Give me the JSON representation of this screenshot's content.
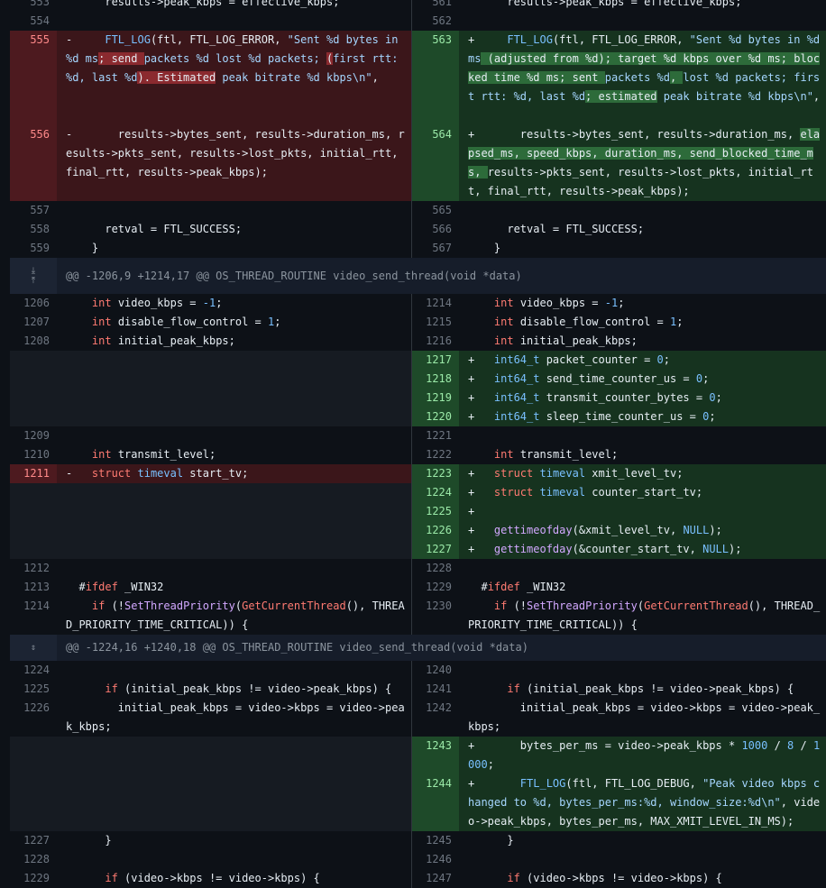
{
  "theme": {
    "background": "#0d1117",
    "deletion_line": "#3b161a",
    "addition_line": "#16331f",
    "deletion_highlight": "#8b2a2f",
    "addition_highlight": "#2d6b3a",
    "keyword": "#ff7b72",
    "type": "#79c0ff"
  },
  "diff": {
    "rows": [
      {
        "kind": "ctx",
        "h": 21,
        "l": {
          "n": "553",
          "t": "      results->peak_kbps = effective_kbps;"
        },
        "r": {
          "n": "561",
          "t": "      results->peak_kbps = effective_kbps;"
        }
      },
      {
        "kind": "ctx",
        "h": 21,
        "l": {
          "n": "554",
          "t": ""
        },
        "r": {
          "n": "562",
          "t": ""
        }
      },
      {
        "kind": "change",
        "h": 105,
        "l": {
          "n": "555",
          "segs": [
            [
              "-     ",
              ""
            ],
            [
              "FTL_LOG",
              "mac"
            ],
            [
              "(ftl, FTL_LOG_ERROR, ",
              ""
            ],
            [
              "\"Sent %d bytes in %d ms",
              "st"
            ],
            [
              "; send ",
              "hl-del"
            ],
            [
              "packets %d lost %d packets; ",
              "st"
            ],
            [
              "(",
              "hl-del"
            ],
            [
              "first rtt: %d, last %d",
              "st"
            ],
            [
              "). Estimated",
              "hl-del"
            ],
            [
              " peak bitrate %d kbps\\n\"",
              "st"
            ],
            [
              ",",
              ""
            ]
          ]
        },
        "r": {
          "n": "563",
          "segs": [
            [
              "+     ",
              ""
            ],
            [
              "FTL_LOG",
              "mac"
            ],
            [
              "(ftl, FTL_LOG_ERROR, ",
              ""
            ],
            [
              "\"Sent %d bytes in %d ms",
              "st"
            ],
            [
              " (adjusted from %d); target %d kbps over %d ms; blocked time %d ms; sent ",
              "hl-add"
            ],
            [
              "packets %d",
              "st"
            ],
            [
              ", ",
              "hl-add"
            ],
            [
              "lost %d packets; first rtt: %d, last %d",
              "st"
            ],
            [
              "; estimated",
              "hl-add"
            ],
            [
              " peak bitrate %d kbps\\n\"",
              "st"
            ],
            [
              ",",
              ""
            ]
          ]
        }
      },
      {
        "kind": "change",
        "h": 84,
        "l": {
          "n": "556",
          "segs": [
            [
              "-       results->bytes_sent, results->duration_ms, results->pkts_sent, results->lost_pkts, initial_rtt, final_rtt, results->peak_kbps);",
              ""
            ]
          ]
        },
        "r": {
          "n": "564",
          "segs": [
            [
              "+       results->bytes_sent, results->duration_ms, ",
              ""
            ],
            [
              "elapsed_ms, speed_kbps, duration_ms, send_blocked_time_ms, ",
              "hl-add"
            ],
            [
              "results->pkts_sent, results->lost_pkts, initial_rtt, final_rtt, results->peak_kbps);",
              ""
            ]
          ]
        }
      },
      {
        "kind": "ctx",
        "h": 21,
        "l": {
          "n": "557",
          "t": ""
        },
        "r": {
          "n": "565",
          "t": ""
        }
      },
      {
        "kind": "ctx",
        "h": 21,
        "l": {
          "n": "558",
          "t": "      retval = FTL_SUCCESS;"
        },
        "r": {
          "n": "566",
          "t": "      retval = FTL_SUCCESS;"
        }
      },
      {
        "kind": "ctx",
        "h": 21,
        "l": {
          "n": "559",
          "t": "    }"
        },
        "r": {
          "n": "567",
          "t": "    }"
        }
      },
      {
        "kind": "hunk",
        "h": 40,
        "t": "@@ -1206,9 +1214,17 @@ OS_THREAD_ROUTINE video_send_thread(void *data)",
        "icons": [
          "expand-down-icon",
          "expand-up-icon"
        ]
      },
      {
        "kind": "ctx",
        "h": 21,
        "l": {
          "n": "1206",
          "segs": [
            [
              "    ",
              ""
            ],
            [
              "int",
              "kw"
            ],
            [
              " video_kbps = ",
              ""
            ],
            [
              "-1",
              "nu"
            ],
            [
              ";",
              ""
            ]
          ]
        },
        "r": {
          "n": "1214",
          "segs": [
            [
              "    ",
              ""
            ],
            [
              "int",
              "kw"
            ],
            [
              " video_kbps = ",
              ""
            ],
            [
              "-1",
              "nu"
            ],
            [
              ";",
              ""
            ]
          ]
        }
      },
      {
        "kind": "ctx",
        "h": 21,
        "l": {
          "n": "1207",
          "segs": [
            [
              "    ",
              ""
            ],
            [
              "int",
              "kw"
            ],
            [
              " disable_flow_control = ",
              ""
            ],
            [
              "1",
              "nu"
            ],
            [
              ";",
              ""
            ]
          ]
        },
        "r": {
          "n": "1215",
          "segs": [
            [
              "    ",
              ""
            ],
            [
              "int",
              "kw"
            ],
            [
              " disable_flow_control = ",
              ""
            ],
            [
              "1",
              "nu"
            ],
            [
              ";",
              ""
            ]
          ]
        }
      },
      {
        "kind": "ctx",
        "h": 21,
        "l": {
          "n": "1208",
          "segs": [
            [
              "    ",
              ""
            ],
            [
              "int",
              "kw"
            ],
            [
              " initial_peak_kbps;",
              ""
            ]
          ]
        },
        "r": {
          "n": "1216",
          "segs": [
            [
              "    ",
              ""
            ],
            [
              "int",
              "kw"
            ],
            [
              " initial_peak_kbps;",
              ""
            ]
          ]
        }
      },
      {
        "kind": "add",
        "h": 21,
        "r": {
          "n": "1217",
          "segs": [
            [
              "+   ",
              ""
            ],
            [
              "int64_t",
              "ty"
            ],
            [
              " packet_counter = ",
              ""
            ],
            [
              "0",
              "nu"
            ],
            [
              ";",
              ""
            ]
          ]
        }
      },
      {
        "kind": "add",
        "h": 21,
        "r": {
          "n": "1218",
          "segs": [
            [
              "+   ",
              ""
            ],
            [
              "int64_t",
              "ty"
            ],
            [
              " send_time_counter_us = ",
              ""
            ],
            [
              "0",
              "nu"
            ],
            [
              ";",
              ""
            ]
          ]
        }
      },
      {
        "kind": "add",
        "h": 21,
        "r": {
          "n": "1219",
          "segs": [
            [
              "+   ",
              ""
            ],
            [
              "int64_t",
              "ty"
            ],
            [
              " transmit_counter_bytes = ",
              ""
            ],
            [
              "0",
              "nu"
            ],
            [
              ";",
              ""
            ]
          ]
        }
      },
      {
        "kind": "add",
        "h": 21,
        "r": {
          "n": "1220",
          "segs": [
            [
              "+   ",
              ""
            ],
            [
              "int64_t",
              "ty"
            ],
            [
              " sleep_time_counter_us = ",
              ""
            ],
            [
              "0",
              "nu"
            ],
            [
              ";",
              ""
            ]
          ]
        }
      },
      {
        "kind": "ctx",
        "h": 21,
        "l": {
          "n": "1209",
          "t": ""
        },
        "r": {
          "n": "1221",
          "t": ""
        }
      },
      {
        "kind": "ctx",
        "h": 21,
        "l": {
          "n": "1210",
          "segs": [
            [
              "    ",
              ""
            ],
            [
              "int",
              "kw"
            ],
            [
              " transmit_level;",
              ""
            ]
          ]
        },
        "r": {
          "n": "1222",
          "segs": [
            [
              "    ",
              ""
            ],
            [
              "int",
              "kw"
            ],
            [
              " transmit_level;",
              ""
            ]
          ]
        }
      },
      {
        "kind": "change",
        "h": 21,
        "l": {
          "n": "1211",
          "segs": [
            [
              "-   ",
              ""
            ],
            [
              "struct",
              "kw"
            ],
            [
              " ",
              ""
            ],
            [
              "timeval",
              "ty"
            ],
            [
              " start_tv;",
              ""
            ]
          ]
        },
        "r": {
          "n": "1223",
          "segs": [
            [
              "+   ",
              ""
            ],
            [
              "struct",
              "kw"
            ],
            [
              " ",
              ""
            ],
            [
              "timeval",
              "ty"
            ],
            [
              " xmit_level_tv;",
              ""
            ]
          ]
        }
      },
      {
        "kind": "add",
        "h": 21,
        "r": {
          "n": "1224",
          "segs": [
            [
              "+   ",
              ""
            ],
            [
              "struct",
              "kw"
            ],
            [
              " ",
              ""
            ],
            [
              "timeval",
              "ty"
            ],
            [
              " counter_start_tv;",
              ""
            ]
          ]
        }
      },
      {
        "kind": "add",
        "h": 21,
        "r": {
          "n": "1225",
          "segs": [
            [
              "+",
              ""
            ]
          ]
        }
      },
      {
        "kind": "add",
        "h": 21,
        "r": {
          "n": "1226",
          "segs": [
            [
              "+   ",
              ""
            ],
            [
              "gettimeofday",
              "fn"
            ],
            [
              "(&xmit_level_tv, ",
              ""
            ],
            [
              "NULL",
              "nu"
            ],
            [
              ");",
              ""
            ]
          ]
        }
      },
      {
        "kind": "add",
        "h": 21,
        "r": {
          "n": "1227",
          "segs": [
            [
              "+   ",
              ""
            ],
            [
              "gettimeofday",
              "fn"
            ],
            [
              "(&counter_start_tv, ",
              ""
            ],
            [
              "NULL",
              "nu"
            ],
            [
              ");",
              ""
            ]
          ]
        }
      },
      {
        "kind": "ctx",
        "h": 21,
        "l": {
          "n": "1212",
          "t": ""
        },
        "r": {
          "n": "1228",
          "t": ""
        }
      },
      {
        "kind": "ctx",
        "h": 21,
        "l": {
          "n": "1213",
          "segs": [
            [
              "  #",
              ""
            ],
            [
              "ifdef",
              "kw"
            ],
            [
              " _WIN32",
              ""
            ]
          ]
        },
        "r": {
          "n": "1229",
          "segs": [
            [
              "  #",
              ""
            ],
            [
              "ifdef",
              "kw"
            ],
            [
              " _WIN32",
              ""
            ]
          ]
        }
      },
      {
        "kind": "ctx",
        "h": 42,
        "l": {
          "n": "1214",
          "segs": [
            [
              "    ",
              ""
            ],
            [
              "if",
              "kw"
            ],
            [
              " (!",
              ""
            ],
            [
              "SetThreadPriority",
              "fn"
            ],
            [
              "(",
              ""
            ],
            [
              "GetCurrentThread",
              "kw"
            ],
            [
              "(), THREAD_PRIORITY_TIME_CRITICAL)) {",
              ""
            ]
          ]
        },
        "r": {
          "n": "1230",
          "segs": [
            [
              "    ",
              ""
            ],
            [
              "if",
              "kw"
            ],
            [
              " (!",
              ""
            ],
            [
              "SetThreadPriority",
              "fn"
            ],
            [
              "(",
              ""
            ],
            [
              "GetCurrentThread",
              "kw"
            ],
            [
              "(), THREAD_PRIORITY_TIME_CRITICAL)) {",
              ""
            ]
          ]
        }
      },
      {
        "kind": "hunk",
        "h": 29,
        "t": "@@ -1224,16 +1240,18 @@ OS_THREAD_ROUTINE video_send_thread(void *data)",
        "icons": [
          "expand-both-icon"
        ]
      },
      {
        "kind": "ctx",
        "h": 21,
        "l": {
          "n": "1224",
          "t": ""
        },
        "r": {
          "n": "1240",
          "t": ""
        }
      },
      {
        "kind": "ctx",
        "h": 21,
        "l": {
          "n": "1225",
          "segs": [
            [
              "      ",
              ""
            ],
            [
              "if",
              "kw"
            ],
            [
              " (initial_peak_kbps != video->peak_kbps) {",
              ""
            ]
          ]
        },
        "r": {
          "n": "1241",
          "segs": [
            [
              "      ",
              ""
            ],
            [
              "if",
              "kw"
            ],
            [
              " (initial_peak_kbps != video->peak_kbps) {",
              ""
            ]
          ]
        }
      },
      {
        "kind": "ctx",
        "h": 42,
        "l": {
          "n": "1226",
          "t": "        initial_peak_kbps = video->kbps = video->peak_kbps;"
        },
        "r": {
          "n": "1242",
          "t": "        initial_peak_kbps = video->kbps = video->peak_kbps;"
        }
      },
      {
        "kind": "add",
        "h": 42,
        "r": {
          "n": "1243",
          "segs": [
            [
              "+       bytes_per_ms = video->peak_kbps * ",
              ""
            ],
            [
              "1000",
              "nu"
            ],
            [
              " / ",
              ""
            ],
            [
              "8",
              "nu"
            ],
            [
              " / ",
              ""
            ],
            [
              "1000",
              "nu"
            ],
            [
              ";",
              ""
            ]
          ]
        }
      },
      {
        "kind": "add",
        "h": 63,
        "r": {
          "n": "1244",
          "segs": [
            [
              "+       ",
              ""
            ],
            [
              "FTL_LOG",
              "mac"
            ],
            [
              "(ftl, FTL_LOG_DEBUG, ",
              ""
            ],
            [
              "\"Peak video kbps changed to %d, bytes_per_ms:%d, window_size:%d\\n\"",
              "st"
            ],
            [
              ", video->peak_kbps, bytes_per_ms, MAX_XMIT_LEVEL_IN_MS);",
              ""
            ]
          ]
        }
      },
      {
        "kind": "ctx",
        "h": 21,
        "l": {
          "n": "1227",
          "t": "      }"
        },
        "r": {
          "n": "1245",
          "t": "      }"
        }
      },
      {
        "kind": "ctx",
        "h": 21,
        "l": {
          "n": "1228",
          "t": ""
        },
        "r": {
          "n": "1246",
          "t": ""
        }
      },
      {
        "kind": "ctx",
        "h": 21,
        "l": {
          "n": "1229",
          "segs": [
            [
              "      ",
              ""
            ],
            [
              "if",
              "kw"
            ],
            [
              " (video->kbps != video->kbps) {",
              ""
            ]
          ]
        },
        "r": {
          "n": "1247",
          "segs": [
            [
              "      ",
              ""
            ],
            [
              "if",
              "kw"
            ],
            [
              " (video->kbps != video->kbps) {",
              ""
            ]
          ]
        }
      }
    ]
  }
}
